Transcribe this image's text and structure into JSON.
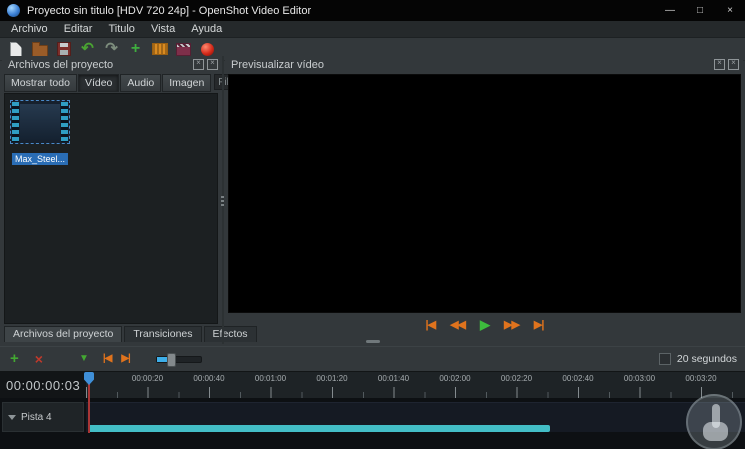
{
  "window": {
    "title": "Proyecto sin titulo [HDV 720 24p] - OpenShot Video Editor",
    "minimize": "—",
    "maximize": "□",
    "close": "×"
  },
  "menu": {
    "items": [
      "Archivo",
      "Editar",
      "Titulo",
      "Vista",
      "Ayuda"
    ]
  },
  "toolbar": {
    "icons": [
      "new-project-icon",
      "open-project-icon",
      "save-project-icon",
      "undo-icon",
      "redo-icon",
      "import-files-icon",
      "profile-icon",
      "title-icon",
      "export-video-icon"
    ],
    "undo_glyph": "↶",
    "redo_glyph": "↷",
    "import_glyph": "+"
  },
  "project_files": {
    "title": "Archivos del proyecto",
    "tabs": [
      "Mostrar todo",
      "Vídeo",
      "Audio",
      "Imagen"
    ],
    "selected_tab": "Vídeo",
    "filter_placeholder": "Filtro",
    "files": [
      {
        "label": "Max_Steel..."
      }
    ]
  },
  "preview": {
    "title": "Previsualizar vídeo",
    "controls": [
      {
        "name": "jump-to-start",
        "glyph": "|◀"
      },
      {
        "name": "rewind",
        "glyph": "◀◀"
      },
      {
        "name": "play",
        "glyph": "▶"
      },
      {
        "name": "fast-forward",
        "glyph": "▶▶"
      },
      {
        "name": "jump-to-end",
        "glyph": "▶|"
      }
    ]
  },
  "lower_tabs": [
    "Archivos del proyecto",
    "Transiciones",
    "Efectos"
  ],
  "timeline": {
    "toolbar": {
      "add_track_glyph": "+",
      "razor_glyph": "×",
      "snapping_glyph": "▼",
      "prev_marker_glyph": "|◀",
      "next_marker_glyph": "▶|",
      "zoom_label": "20 segundos"
    },
    "timecode": "00:00:00:03",
    "ruler_labels": [
      "00:00:20",
      "00:00:40",
      "00:01:00",
      "00:01:20",
      "00:01:40",
      "00:02:00",
      "00:02:20",
      "00:02:40",
      "00:03:00",
      "00:03:20"
    ],
    "tracks": [
      {
        "label": "Pista 4"
      }
    ]
  },
  "colors": {
    "accent_blue": "#3daee9",
    "play_green": "#3dbb3d",
    "seek_orange": "#e0731d",
    "teal_bar": "#43bec6",
    "playhead_red": "#a93636",
    "selection_blue": "#2a6db5"
  }
}
